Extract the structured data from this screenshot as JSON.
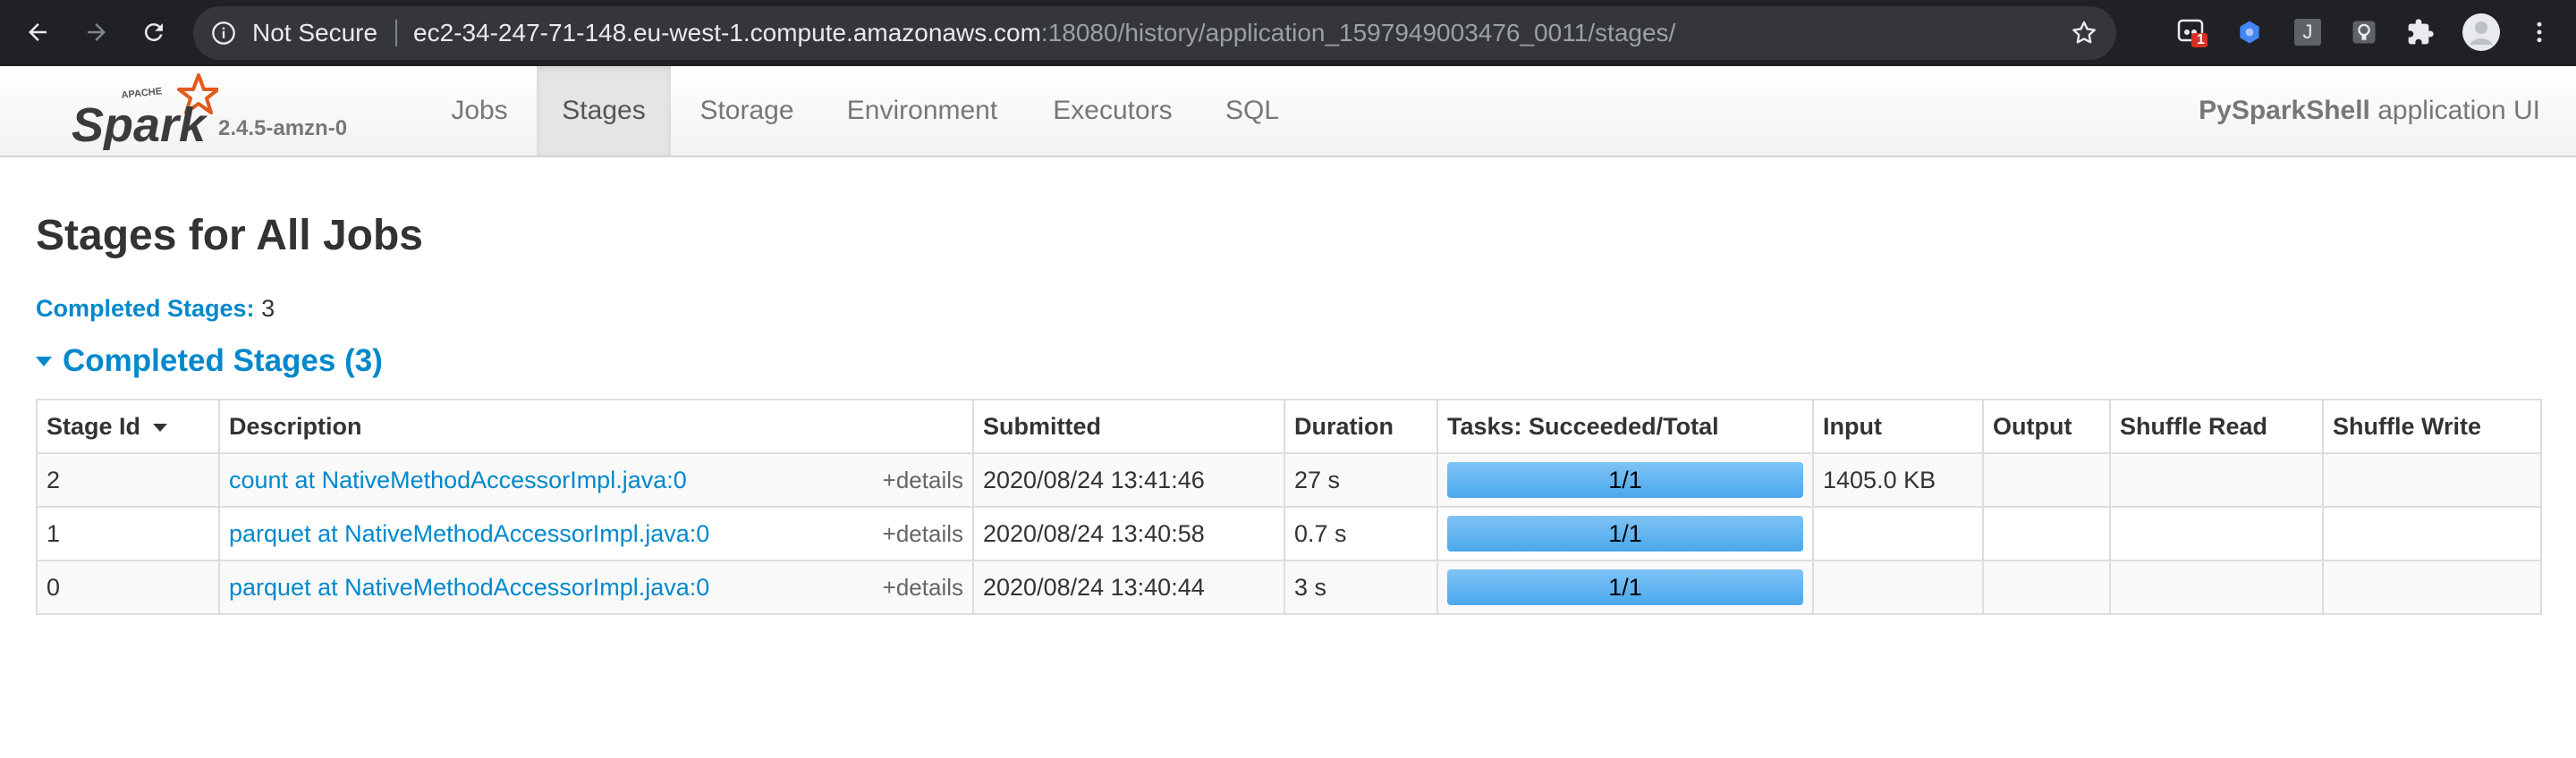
{
  "browser": {
    "security_label": "Not Secure",
    "url_host": "ec2-34-247-71-148.eu-west-1.compute.amazonaws.com",
    "url_path": ":18080/history/application_1597949003476_0011/stages/",
    "extension_badge": "1",
    "extension_letter": "J",
    "icons": [
      "back-icon",
      "forward-icon",
      "reload-icon",
      "info-icon",
      "star-icon",
      "extension-icon",
      "puzzle-icon",
      "profile-icon",
      "menu-icon"
    ]
  },
  "spark": {
    "logo_small": "APACHE",
    "logo_word": "Spark",
    "version": "2.4.5-amzn-0",
    "tabs": [
      {
        "label": "Jobs",
        "active": false
      },
      {
        "label": "Stages",
        "active": true
      },
      {
        "label": "Storage",
        "active": false
      },
      {
        "label": "Environment",
        "active": false
      },
      {
        "label": "Executors",
        "active": false
      },
      {
        "label": "SQL",
        "active": false
      }
    ],
    "app_name": "PySparkShell",
    "app_suffix": " application UI"
  },
  "page": {
    "title": "Stages for All Jobs",
    "summary_label": "Completed Stages:",
    "summary_count": "3",
    "section_title": "Completed Stages (3)"
  },
  "table": {
    "columns": [
      "Stage Id",
      "Description",
      "Submitted",
      "Duration",
      "Tasks: Succeeded/Total",
      "Input",
      "Output",
      "Shuffle Read",
      "Shuffle Write"
    ],
    "details_label": "+details",
    "rows": [
      {
        "stage_id": "2",
        "description": "count at NativeMethodAccessorImpl.java:0",
        "submitted": "2020/08/24 13:41:46",
        "duration": "27 s",
        "tasks": "1/1",
        "tasks_fraction": 1.0,
        "input": "1405.0 KB",
        "output": "",
        "shuffle_read": "",
        "shuffle_write": ""
      },
      {
        "stage_id": "1",
        "description": "parquet at NativeMethodAccessorImpl.java:0",
        "submitted": "2020/08/24 13:40:58",
        "duration": "0.7 s",
        "tasks": "1/1",
        "tasks_fraction": 1.0,
        "input": "",
        "output": "",
        "shuffle_read": "",
        "shuffle_write": ""
      },
      {
        "stage_id": "0",
        "description": "parquet at NativeMethodAccessorImpl.java:0",
        "submitted": "2020/08/24 13:40:44",
        "duration": "3 s",
        "tasks": "1/1",
        "tasks_fraction": 1.0,
        "input": "",
        "output": "",
        "shuffle_read": "",
        "shuffle_write": ""
      }
    ]
  },
  "colors": {
    "link": "#0088cc",
    "progress": "#4aa8ec",
    "spark_orange": "#e25a1c",
    "browser_bg": "#202124"
  }
}
